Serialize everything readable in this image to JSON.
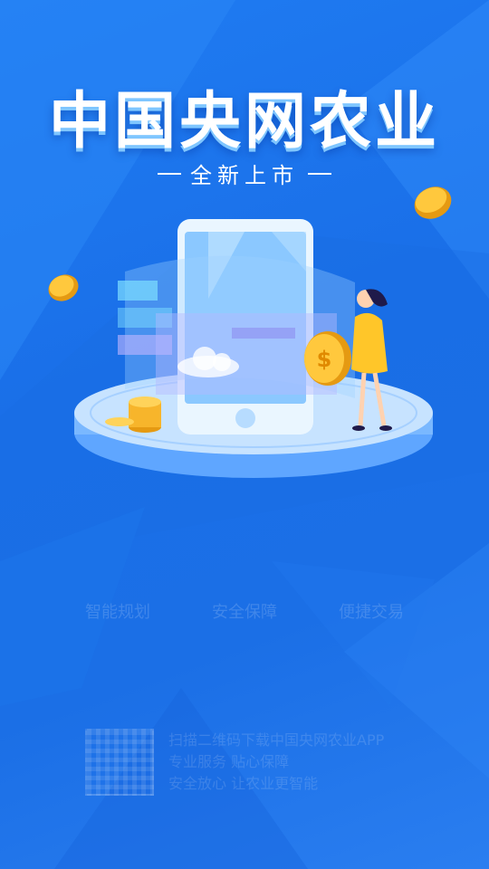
{
  "splash": {
    "title": "中国央网农业",
    "subtitle": "全新上市",
    "features": [
      "智能规划",
      "安全保障",
      "便捷交易"
    ],
    "footer_lines": [
      "扫描二维码下载中国央网农业APP",
      "专业服务 贴心保障",
      "安全放心 让农业更智能"
    ]
  },
  "colors": {
    "background": "#1b6fe6",
    "title_shadow": "#7fc6ff",
    "coin": "#f6b52b"
  },
  "icons": [
    "phone-illustration",
    "coin-icon",
    "cloud-icon",
    "woman-figure"
  ]
}
